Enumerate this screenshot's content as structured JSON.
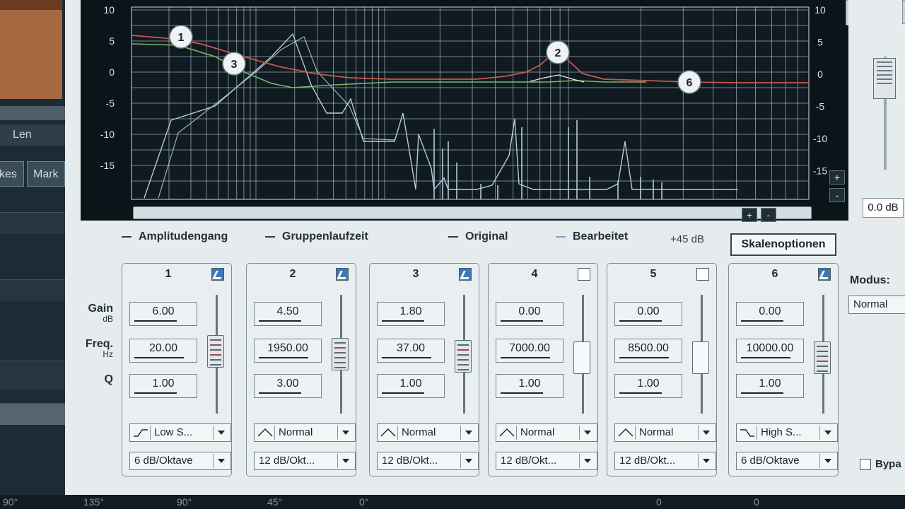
{
  "background_window": {
    "len_label": "Len",
    "tab_left": "kes",
    "tab_mark": "Mark"
  },
  "graph": {
    "left_axis": [
      "10",
      "5",
      "0",
      "-5",
      "-10",
      "-15"
    ],
    "right_axis": [
      "10",
      "5",
      "0",
      "-5",
      "-10",
      "-15"
    ],
    "markers": [
      "1",
      "2",
      "3",
      "6"
    ],
    "zoom_plus": "+",
    "zoom_minus": "-",
    "colors": {
      "amplitude": "#c6574a",
      "group_delay": "#7fb56b",
      "spectrum": "#b8cad8",
      "grid": "#cfdbe3"
    }
  },
  "legend": {
    "amplitude": "Amplitudengang",
    "group_delay": "Gruppenlaufzeit",
    "original": "Original",
    "edited": "Bearbeitet",
    "db_range": "+45 dB",
    "scale_options": "Skalenoptionen"
  },
  "row_labels": {
    "gain": "Gain",
    "gain_unit": "dB",
    "freq": "Freq.",
    "freq_unit": "Hz",
    "q": "Q"
  },
  "bands": [
    {
      "number": "1",
      "gain": "6.00",
      "freq": "20.00",
      "q": "1.00",
      "filter": "Low S...",
      "slope": "6 dB/Oktave",
      "enabled": true,
      "level": 0.56
    },
    {
      "number": "2",
      "gain": "4.50",
      "freq": "1950.00",
      "q": "3.00",
      "filter": "Normal",
      "slope": "12 dB/Okt...",
      "enabled": true,
      "level": 0.53
    },
    {
      "number": "3",
      "gain": "1.80",
      "freq": "37.00",
      "q": "1.00",
      "filter": "Normal",
      "slope": "12 dB/Okt...",
      "enabled": true,
      "level": 0.51
    },
    {
      "number": "4",
      "gain": "0.00",
      "freq": "7000.00",
      "q": "1.00",
      "filter": "Normal",
      "slope": "12 dB/Okt...",
      "enabled": false,
      "level": 0.5
    },
    {
      "number": "5",
      "gain": "0.00",
      "freq": "8500.00",
      "q": "1.00",
      "filter": "Normal",
      "slope": "12 dB/Okt...",
      "enabled": false,
      "level": 0.5
    },
    {
      "number": "6",
      "gain": "0.00",
      "freq": "10000.00",
      "q": "1.00",
      "filter": "High S...",
      "slope": "6 dB/Oktave",
      "enabled": true,
      "level": 0.5
    }
  ],
  "right_panel": {
    "master_gain": "0.0 dB",
    "modus_label": "Modus:",
    "modus_value": "Normal",
    "bypass_label": "Bypa"
  },
  "bottom_ruler": [
    "90°",
    "135°",
    "90°",
    "45°",
    "0°",
    "0",
    "0"
  ]
}
